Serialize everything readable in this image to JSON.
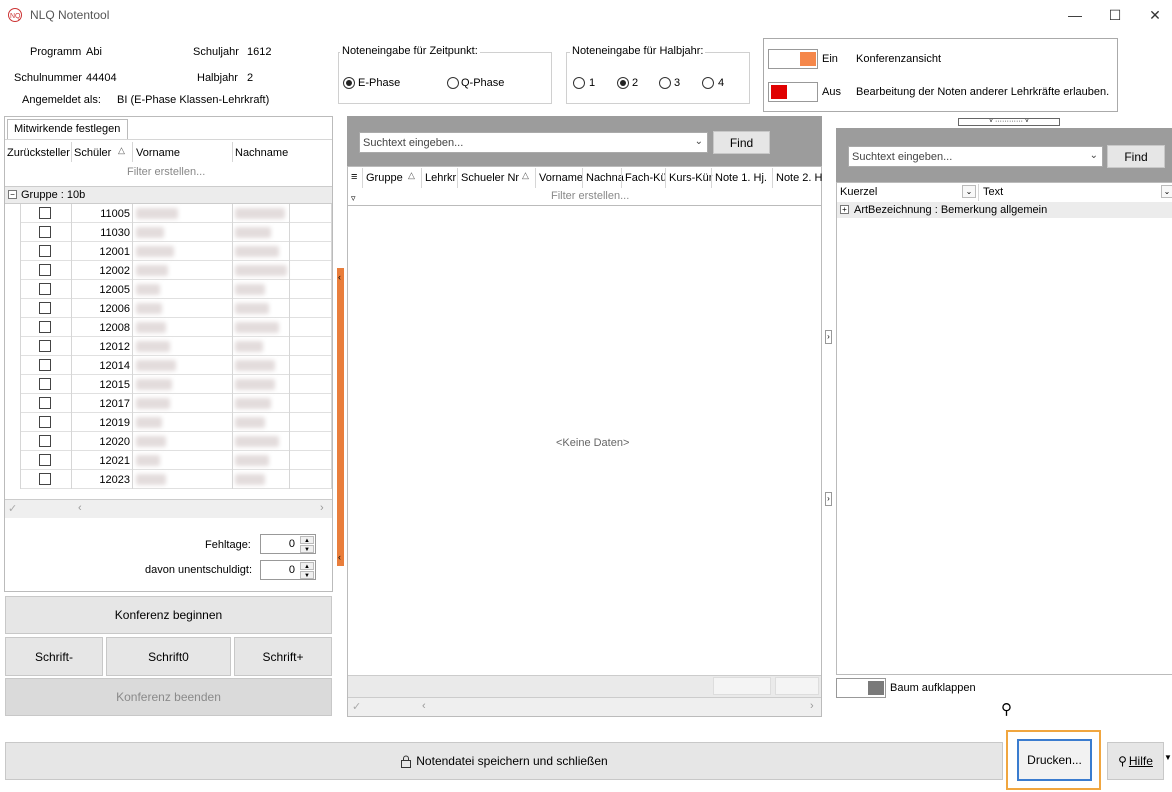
{
  "window": {
    "title": "NLQ Notentool"
  },
  "info": {
    "programm_label": "Programm",
    "programm_value": "Abi",
    "schuljahr_label": "Schuljahr",
    "schuljahr_value": "1612",
    "schulnummer_label": "Schulnummer",
    "schulnummer_value": "44404",
    "halbjahr_label": "Halbjahr",
    "halbjahr_value": "2",
    "angemeldet_label": "Angemeldet als:",
    "angemeldet_value": "BI (E-Phase Klassen-Lehrkraft)"
  },
  "zeitpunkt": {
    "title": "Noteneingabe für Zeitpunkt:",
    "options": [
      "E-Phase",
      "Q-Phase"
    ],
    "selected": "E-Phase"
  },
  "halbjahr_input": {
    "title": "Noteneingabe für Halbjahr:",
    "options": [
      "1",
      "2",
      "3",
      "4"
    ],
    "selected": "2"
  },
  "toggles": {
    "konferenz": {
      "state": "Ein",
      "label": "Konferenzansicht",
      "color": "#f5874a"
    },
    "bearbeitung": {
      "state": "Aus",
      "label": "Bearbeitung der Noten anderer Lehrkräfte erlauben.",
      "color": "#e00000"
    }
  },
  "left_panel": {
    "tab": "Mitwirkende festlegen",
    "columns": [
      "Zurücksteller",
      "Schüler",
      "Vorname",
      "Nachname"
    ],
    "filter_placeholder": "Filter erstellen...",
    "group_label": "Gruppe : 10b",
    "rows": [
      {
        "nr": "11005"
      },
      {
        "nr": "11030"
      },
      {
        "nr": "12001"
      },
      {
        "nr": "12002"
      },
      {
        "nr": "12005"
      },
      {
        "nr": "12006"
      },
      {
        "nr": "12008"
      },
      {
        "nr": "12012"
      },
      {
        "nr": "12014"
      },
      {
        "nr": "12015"
      },
      {
        "nr": "12017"
      },
      {
        "nr": "12019"
      },
      {
        "nr": "12020"
      },
      {
        "nr": "12021"
      },
      {
        "nr": "12023"
      }
    ],
    "fehltage_label": "Fehltage:",
    "fehltage_value": "0",
    "unentschuldigt_label": "davon unentschuldigt:",
    "unentschuldigt_value": "0"
  },
  "buttons": {
    "konferenz_beginnen": "Konferenz beginnen",
    "schrift_minus": "Schrift-",
    "schrift_zero": "Schrift0",
    "schrift_plus": "Schrift+",
    "konferenz_beenden": "Konferenz beenden",
    "speichern": "Notendatei speichern und schließen",
    "drucken": "Drucken...",
    "hilfe": "Hilfe"
  },
  "middle_panel": {
    "search_placeholder": "Suchtext eingeben...",
    "find": "Find",
    "columns": [
      "Gruppe",
      "Lehrkr",
      "Schueler Nr",
      "Vorname",
      "Nachna",
      "Fach-Kü",
      "Kurs-Kür",
      "Note 1. Hj.",
      "Note 2. H"
    ],
    "filter_placeholder": "Filter erstellen...",
    "empty": "<Keine Daten>"
  },
  "right_panel": {
    "search_placeholder": "Suchtext eingeben...",
    "find": "Find",
    "col_kuerzel": "Kuerzel",
    "col_text": "Text",
    "group_row": "ArtBezeichnung : Bemerkung allgemein",
    "baum_label": "Baum aufklappen"
  }
}
